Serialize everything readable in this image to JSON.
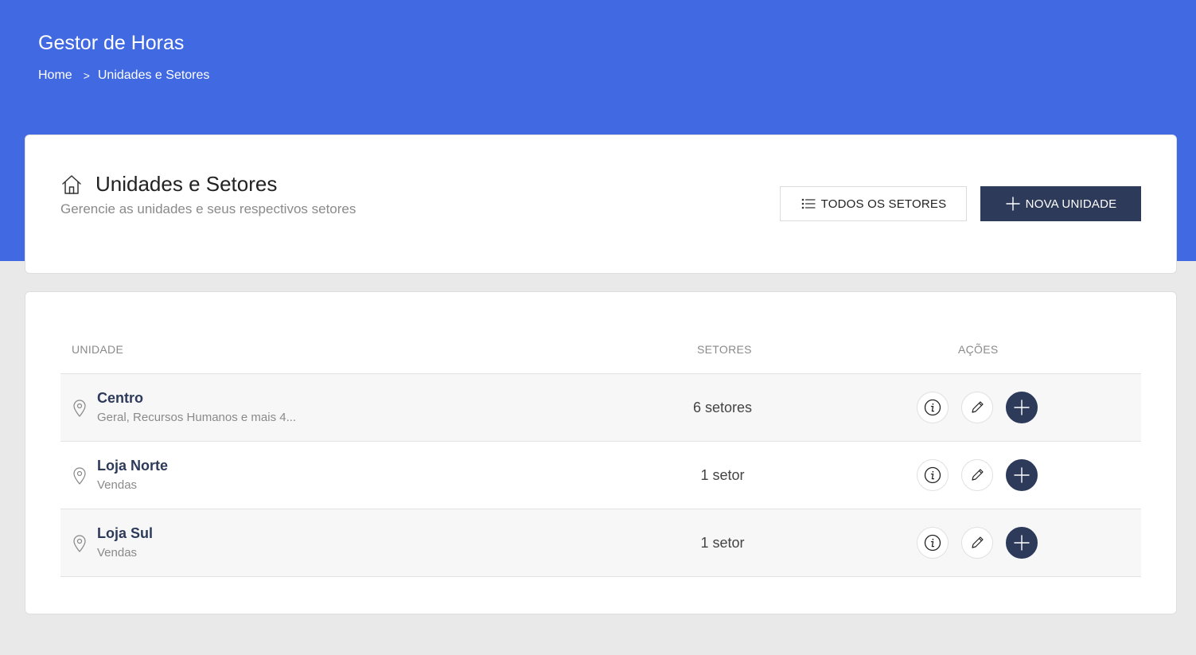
{
  "app": {
    "title": "Gestor de Horas"
  },
  "breadcrumb": {
    "home": "Home",
    "separator": ">",
    "current": "Unidades e Setores"
  },
  "header": {
    "icon": "home-icon",
    "title": "Unidades e Setores",
    "subtitle": "Gerencie as unidades e seus respectivos setores",
    "buttons": {
      "all_sectors": "TODOS OS SETORES",
      "new_unit": "NOVA UNIDADE"
    }
  },
  "table": {
    "columns": {
      "unit": "UNIDADE",
      "sectors": "SETORES",
      "actions": "AÇÕES"
    },
    "rows": [
      {
        "name": "Centro",
        "sectors_list": "Geral, Recursos Humanos e mais 4...",
        "sector_count": "6 setores"
      },
      {
        "name": "Loja Norte",
        "sectors_list": "Vendas",
        "sector_count": "1 setor"
      },
      {
        "name": "Loja Sul",
        "sectors_list": "Vendas",
        "sector_count": "1 setor"
      }
    ]
  },
  "colors": {
    "primary": "#4169e1",
    "dark": "#2d3a5a",
    "background": "#e9e9e9",
    "muted": "#8a8a8a"
  }
}
